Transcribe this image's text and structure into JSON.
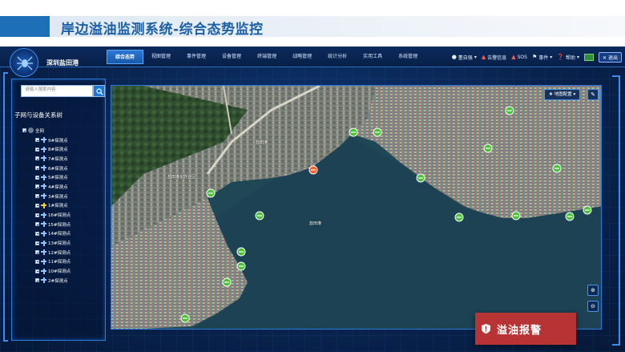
{
  "slide": {
    "title": "岸边溢油监测系统-综合态势监控"
  },
  "header": {
    "port_name": "深圳盐田港",
    "nav": [
      "综合态势",
      "视图管理",
      "事件管理",
      "设备管理",
      "终端管理",
      "战略管理",
      "统计分析",
      "实用工具",
      "系统管理"
    ],
    "active_nav_index": 0,
    "tools": {
      "user": "董自强",
      "alarm_info": "告警信息",
      "sos": "SOS",
      "events": "事件",
      "help": "帮助",
      "exit": "退出"
    }
  },
  "sidebar": {
    "search_placeholder": "请输入搜索内容",
    "tree_title": "子网与设备关系树",
    "root_label": "全网",
    "nodes": [
      {
        "label": "9#探测点",
        "warn": false
      },
      {
        "label": "8#探测点",
        "warn": false
      },
      {
        "label": "7#探测点",
        "warn": false
      },
      {
        "label": "6#探测点",
        "warn": false
      },
      {
        "label": "5#探测点",
        "warn": false
      },
      {
        "label": "4#探测点",
        "warn": false
      },
      {
        "label": "3#探测点",
        "warn": false
      },
      {
        "label": "1#探测点",
        "warn": true
      },
      {
        "label": "16#探测点",
        "warn": false
      },
      {
        "label": "15#探测点",
        "warn": false
      },
      {
        "label": "14#探测点",
        "warn": false
      },
      {
        "label": "13#探测点",
        "warn": false
      },
      {
        "label": "12#探测点",
        "warn": false
      },
      {
        "label": "11#探测点",
        "warn": false
      },
      {
        "label": "10#探测点",
        "warn": false
      },
      {
        "label": "2#探测点",
        "warn": false
      }
    ]
  },
  "map": {
    "layer_button": "地图配置",
    "labels": {
      "yantian_port": "盐田港",
      "yantian_town": "盐田港",
      "harbor_area": "盐田港东作业区"
    },
    "zoom_in_icon": "zoom-in-icon",
    "zoom_out_icon": "zoom-out-icon",
    "colors": {
      "ok_marker": "#4bc13a",
      "alarm_marker": "#ff5a2c"
    }
  },
  "alarm": {
    "label": "溢油报警",
    "color": "#b83434"
  }
}
